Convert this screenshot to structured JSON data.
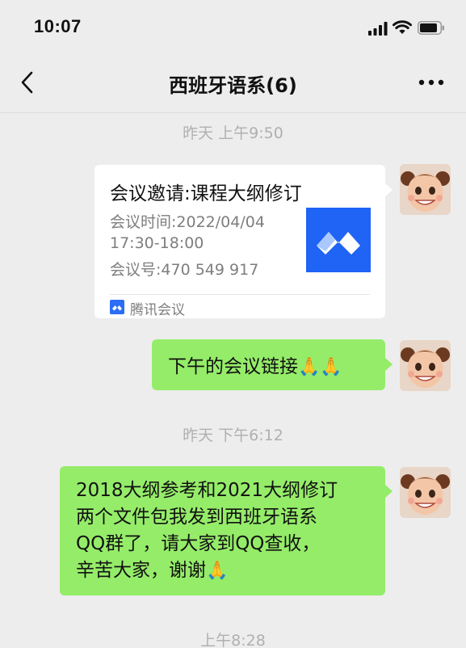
{
  "status_bar": {
    "time": "10:07"
  },
  "nav": {
    "title": "西班牙语系(6)"
  },
  "messages": {
    "ts1": "昨天 上午9:50",
    "card": {
      "title": "会议邀请:课程大纲修订",
      "line1": "会议时间:2022/04/04",
      "line2": "17:30-18:00",
      "line3": "会议号:470 549 917",
      "source": "腾讯会议"
    },
    "msg1": {
      "text": "下午的会议链接",
      "emoji": "🙏🙏"
    },
    "ts2": "昨天 下午6:12",
    "msg2": {
      "text": "2018大纲参考和2021大纲修订\n两个文件包我发到西班牙语系\nQQ群了，请大家到QQ查收，\n辛苦大家，谢谢",
      "emoji": "🙏"
    },
    "ts3": "上午8:28"
  },
  "colors": {
    "bubble_green": "#95ec69",
    "background": "#ededed",
    "meeting_blue": "#1f64f5"
  },
  "icons": {
    "back": "chevron-left-icon",
    "more": "more-dots-icon",
    "signal": "signal-icon",
    "wifi": "wifi-icon",
    "battery": "battery-icon"
  }
}
